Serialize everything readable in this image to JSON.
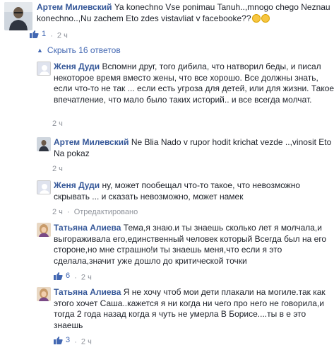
{
  "comments": [
    {
      "author": "Артем Милевский",
      "text": "Ya konechno Vse ponimau Tanuh..,mnogo chego Neznau konechno..,Nu zachem Eto zdes vistavliat v facebooke??",
      "likes": "1",
      "time": "2 ч"
    }
  ],
  "replies_toggle": {
    "label": "Скрыть 16 ответов"
  },
  "replies": [
    {
      "author": "Женя Дуди",
      "text": "Вспомни друг, того дибила, что натворил беды, и писал некоторое время вместо жены, что все хорошо. Все должны знать, если что-то не так ... если есть угроза для детей, или для жизни. Такое впечатление, что мало было таких историй.. и все всегда молчат.",
      "time": "2 ч"
    },
    {
      "author": "Артем Милевский",
      "text": "Ne Blia Nado v rupor hodit krichat vezde ..,vinosit Eto Na pokaz",
      "time": "2 ч"
    },
    {
      "author": "Женя Дуди",
      "text": "ну, может пообещал что-то такое, что невозможно скрывать ... и сказать невозможно, может намек",
      "time": "2 ч",
      "edited": "Отредактировано"
    },
    {
      "author": "Татьяна Алиева",
      "text": "Тема,я знаю.и ты знаешь сколько лет я молчала,и выгораживала его,единственный человек который Всегда был на его стороне,но мне страшно!и ты знаешь меня,что если я это сделала,значит уже дошло до критической точки",
      "likes": "6",
      "time": "2 ч"
    },
    {
      "author": "Татьяна Алиева",
      "text": "Я не хочу чтоб мои дети плакали на могиле.так как этого хочет Саша..кажется я ни когда ни чего про него не говорила,и тогда 2 года назад когда я чуть не умерла В Борисе....ты в е это знаешь",
      "likes": "3",
      "time": "2 ч"
    }
  ],
  "colors": {
    "author": "#365899",
    "link": "#4267b2",
    "meta": "#90949c",
    "text": "#1d2129"
  },
  "icons": {
    "like": "thumbs-up-icon",
    "toggle": "caret-up-icon",
    "emoji_1": "wink-emoji-icon",
    "emoji_2": "laughing-emoji-icon"
  }
}
